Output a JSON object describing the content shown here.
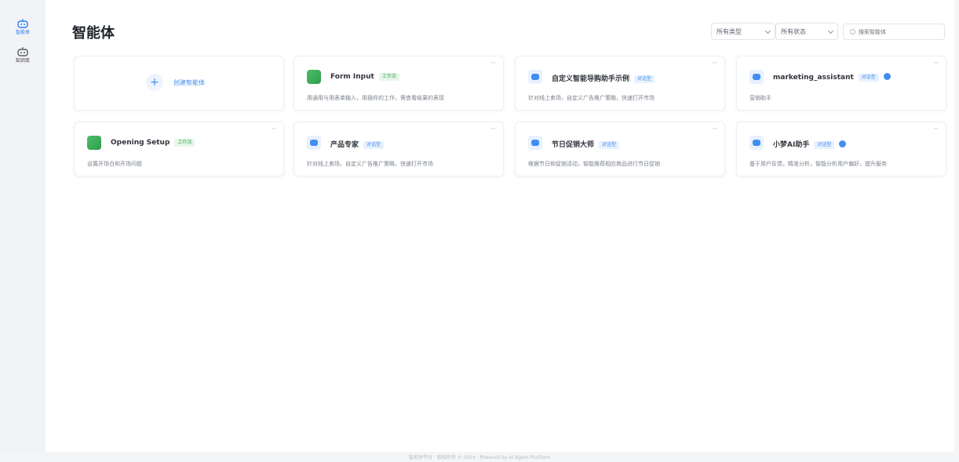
{
  "nav": {
    "items": [
      {
        "label": "智能体",
        "icon": "robot-icon",
        "active": true
      },
      {
        "label": "知识库",
        "icon": "database-icon",
        "active": false
      }
    ]
  },
  "header": {
    "title": "智能体",
    "type_filter": "所有类型",
    "status_filter": "所有状态",
    "search_placeholder": "搜索智能体"
  },
  "create_card": {
    "label": "创建智能体"
  },
  "agents": [
    {
      "name": "Form Input",
      "tag": "工作流",
      "desc": "用通用与用表单输入，用插件的工作，需查看结果的表现",
      "type": "workflow",
      "badge": false
    },
    {
      "name": "自定义智能导购助手示例",
      "tag": "对话型",
      "desc": "针对线上卖场，自定义广告推广策略，快速打开市场",
      "type": "agent",
      "badge": false
    },
    {
      "name": "marketing_assistant",
      "tag": "对话型",
      "desc": "营销助手",
      "type": "agent",
      "badge": true
    },
    {
      "name": "Opening Setup",
      "tag": "工作流",
      "desc": "设置开场白和开场问题",
      "type": "workflow",
      "badge": false
    },
    {
      "name": "产品专家",
      "tag": "对话型",
      "desc": "针对线上卖场，自定义广告推广策略，快速打开市场",
      "type": "agent",
      "badge": false
    },
    {
      "name": "节日促销大师",
      "tag": "对话型",
      "desc": "根据节日和促销活动，智能推荐相应商品进行节日促销",
      "type": "agent",
      "badge": false
    },
    {
      "name": "小梦AI助手",
      "tag": "对话型",
      "desc": "基于用户反馈，精准分析，智能分析用户偏好，提升服务",
      "type": "agent",
      "badge": true
    }
  ],
  "footer": {
    "text": "智能体平台 · 版权所有 © 2024 · Powered by AI Agent Platform"
  },
  "colors": {
    "accent": "#3f8ef0",
    "workflow": "#3eaa58"
  }
}
